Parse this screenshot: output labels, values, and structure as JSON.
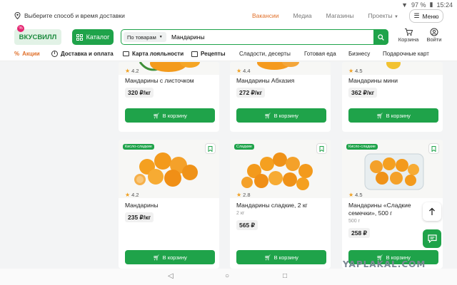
{
  "status": {
    "battery": "97 %",
    "time": "15:24"
  },
  "topbar": {
    "delivery_label": "Выберите способ и время доставки",
    "links": [
      "Вакансии",
      "Медиа",
      "Магазины",
      "Проекты"
    ],
    "menu_label": "Меню"
  },
  "header": {
    "logo_text": "ВКУСВИЛЛ",
    "logo_badge": "%",
    "catalog_label": "Каталог",
    "search_scope": "По товарам",
    "search_query": "Мандарины",
    "cart_label": "Корзина",
    "login_label": "Войти"
  },
  "nav": {
    "promo": "Акции",
    "delivery": "Доставка и оплата",
    "loyalty": "Карта лояльности",
    "recipes": "Рецепты",
    "categories": [
      "Сладости, десерты",
      "Готовая еда",
      "Бизнесу",
      "Подарочные карт"
    ]
  },
  "products": [
    {
      "rating": "4.2",
      "name": "Мандарины с листочком",
      "weight": "",
      "price": "320 ₽/кг",
      "button": "В корзину",
      "badge": ""
    },
    {
      "rating": "4.4",
      "name": "Мандарины Абхазия",
      "weight": "",
      "price": "272 ₽/кг",
      "button": "В корзину",
      "badge": ""
    },
    {
      "rating": "4.5",
      "name": "Мандарины мини",
      "weight": "",
      "price": "362 ₽/кг",
      "button": "В корзину",
      "badge": ""
    },
    {
      "rating": "4.2",
      "name": "Мандарины",
      "weight": "",
      "price": "235 ₽/кг",
      "button": "В корзину",
      "badge": "Кисло-сладкие"
    },
    {
      "rating": "2.8",
      "name": "Мандарины сладкие, 2 кг",
      "weight": "2 кг",
      "price": "565 ₽",
      "button": "В корзину",
      "badge": "Сладкие"
    },
    {
      "rating": "4.5",
      "name": "Мандарины «Сладкие семечки», 500 г",
      "weight": "500 г",
      "price": "258 ₽",
      "button": "В корзину",
      "badge": "Кисло-сладкие"
    }
  ],
  "watermark": "YAPLAKAL.COM",
  "colors": {
    "brand_green": "#1fa34a",
    "accent_orange": "#e0702a"
  }
}
